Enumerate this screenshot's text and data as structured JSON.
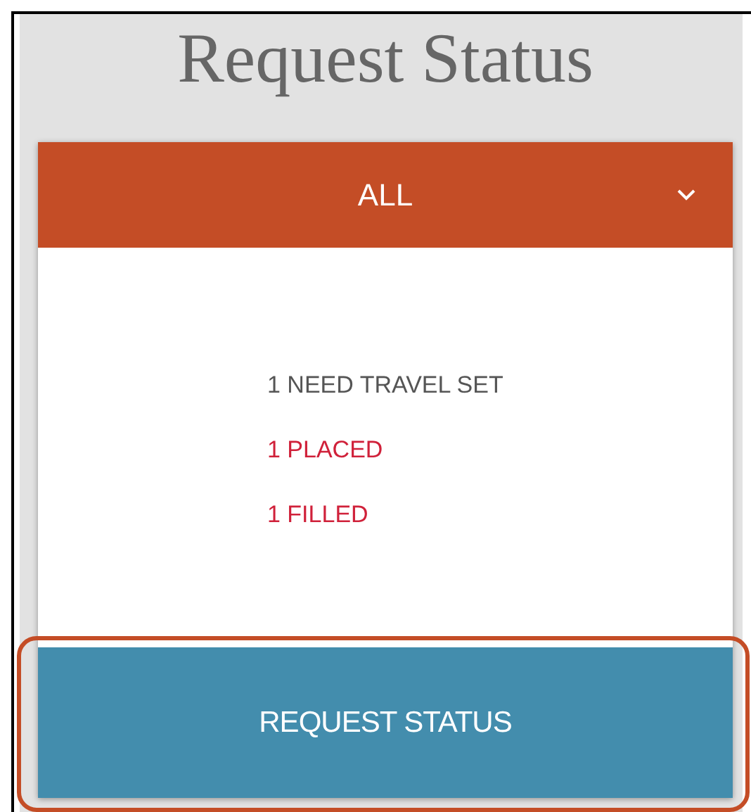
{
  "title": "Request Status",
  "dropdown": {
    "value": "ALL"
  },
  "statuses": [
    {
      "text": "1 NEED TRAVEL SET",
      "color": "#555555"
    },
    {
      "text": "1 PLACED",
      "color": "#d0213a"
    },
    {
      "text": "1 FILLED",
      "color": "#d0213a"
    }
  ],
  "button": {
    "label": "REQUEST STATUS",
    "highlighted": true
  }
}
